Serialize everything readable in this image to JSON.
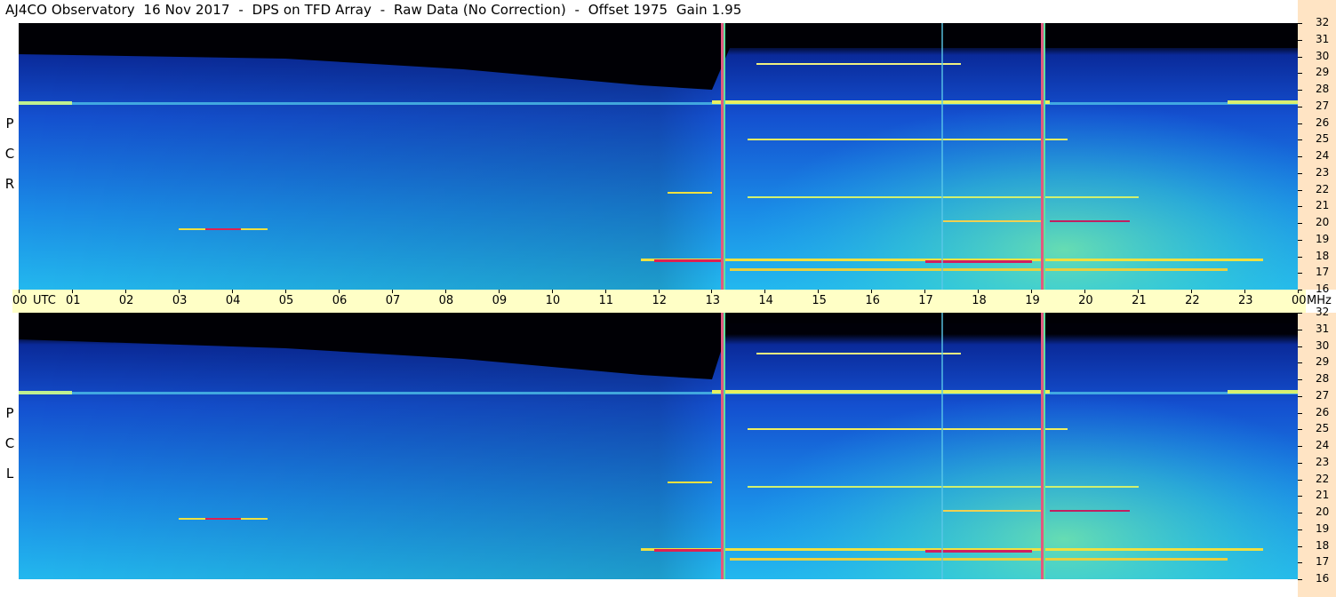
{
  "title": "AJ4CO Observatory  16 Nov 2017  -  DPS on TFD Array  -  Raw Data (No Correction)  -  Offset 1975  Gain 1.95",
  "panels": [
    {
      "id": "rcp",
      "label_letters": [
        "P",
        "C",
        "R"
      ]
    },
    {
      "id": "lcp",
      "label_letters": [
        "P",
        "C",
        "L"
      ]
    }
  ],
  "time_axis": {
    "unit_label": "UTC",
    "freq_unit_label": "MHz",
    "ticks": [
      "00",
      "01",
      "02",
      "03",
      "04",
      "05",
      "06",
      "07",
      "08",
      "09",
      "10",
      "11",
      "12",
      "13",
      "14",
      "15",
      "16",
      "17",
      "18",
      "19",
      "20",
      "21",
      "22",
      "23",
      "00"
    ]
  },
  "freq_axis": {
    "ticks": [
      "32",
      "31",
      "30",
      "29",
      "28",
      "27",
      "26",
      "25",
      "24",
      "23",
      "22",
      "21",
      "20",
      "19",
      "18",
      "17",
      "16"
    ]
  },
  "chart_data": [
    {
      "type": "heatmap",
      "title": "AJ4CO Observatory  16 Nov 2017  -  DPS on TFD Array  -  Raw Data (No Correction)  -  Offset 1975  Gain 1.95",
      "panel": "R C P",
      "x": {
        "label": "UTC",
        "range": [
          "00",
          "00"
        ],
        "unit": "hour"
      },
      "y": {
        "label": "MHz",
        "range": [
          16,
          32
        ]
      },
      "colormap": [
        "#000000",
        "#0a1a7a",
        "#1f6be0",
        "#23b4ee",
        "#6cf0a0",
        "#f0f050",
        "#ff8c00",
        "#e0205a"
      ],
      "notable_features": {
        "broadband_interference_hours": [
          13.2,
          19.2
        ],
        "strong_band_mhz": 27.1
      }
    },
    {
      "type": "heatmap",
      "title": "AJ4CO Observatory  16 Nov 2017  -  DPS on TFD Array  -  Raw Data (No Correction)  -  Offset 1975  Gain 1.95",
      "panel": "L C P",
      "x": {
        "label": "UTC",
        "range": [
          "00",
          "00"
        ],
        "unit": "hour"
      },
      "y": {
        "label": "MHz",
        "range": [
          16,
          32
        ]
      },
      "colormap": [
        "#000000",
        "#0a1a7a",
        "#1f6be0",
        "#23b4ee",
        "#6cf0a0",
        "#f0f050",
        "#ff8c00",
        "#e0205a"
      ],
      "notable_features": {
        "broadband_interference_hours": [
          13.2,
          19.2
        ],
        "strong_band_mhz": 27.1
      }
    }
  ]
}
